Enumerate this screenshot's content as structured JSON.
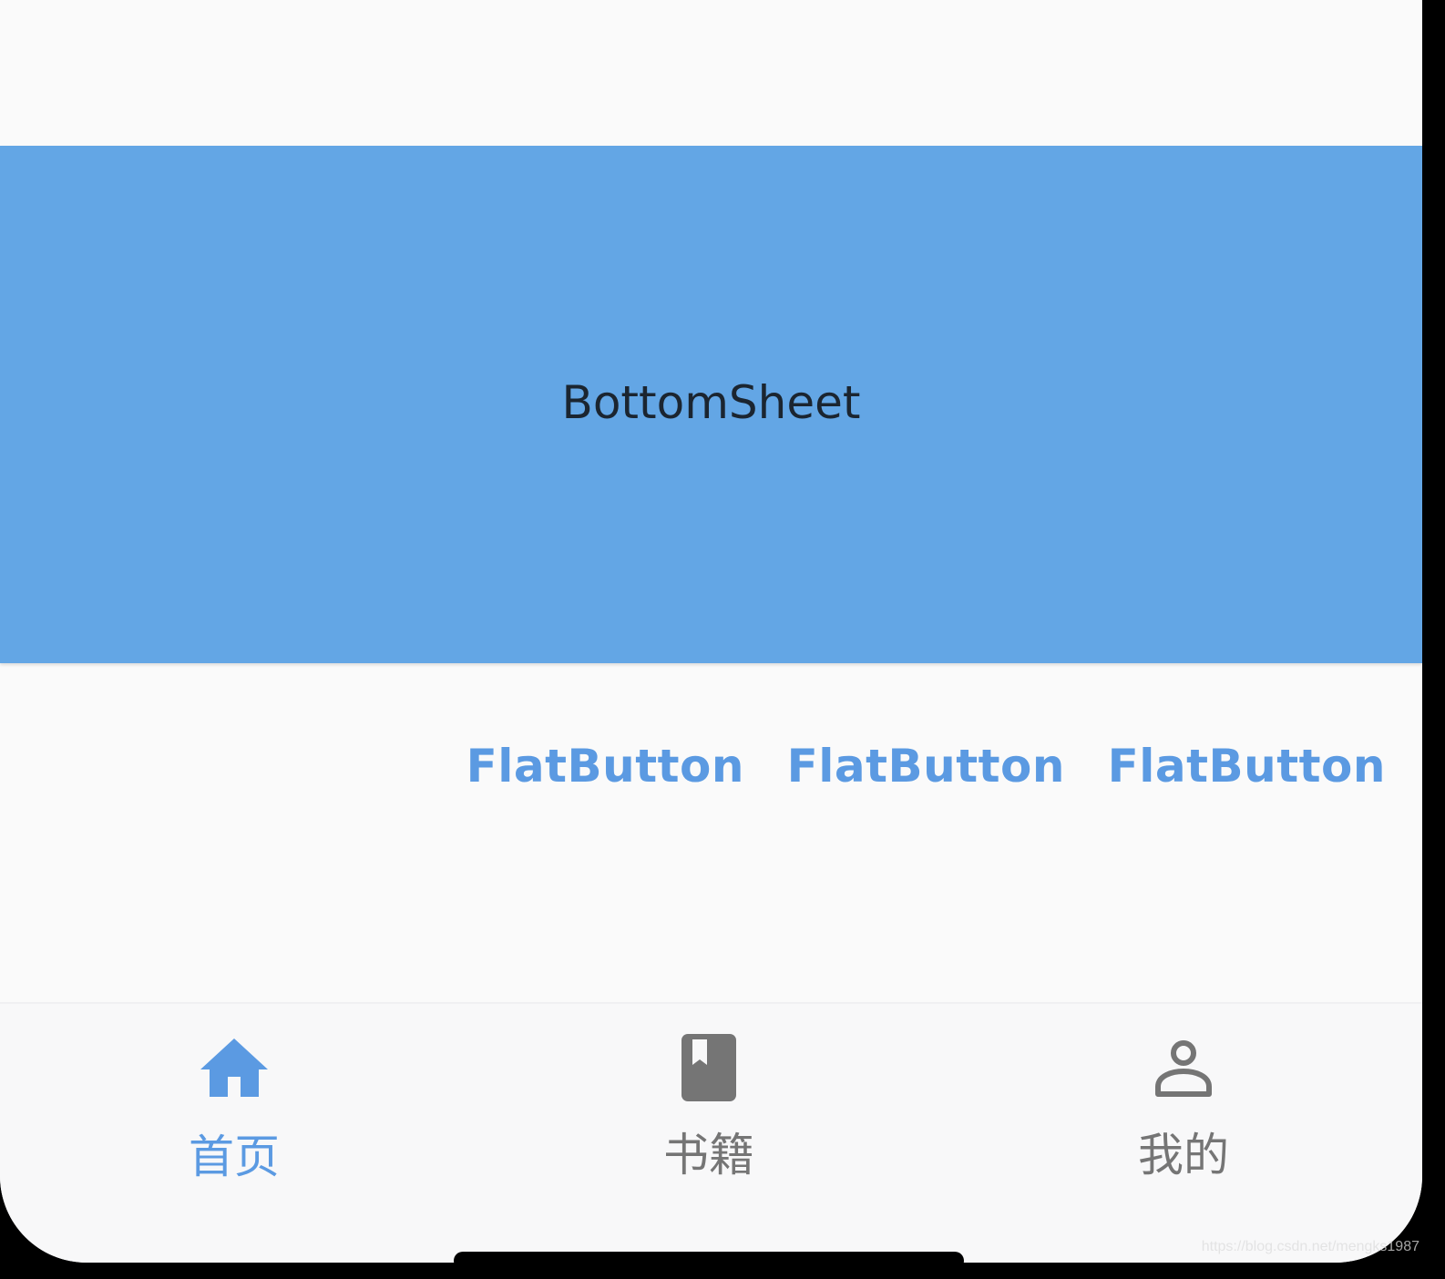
{
  "bottom_sheet": {
    "text": "BottomSheet"
  },
  "buttons": [
    {
      "label": "FlatButton"
    },
    {
      "label": "FlatButton"
    },
    {
      "label": "FlatButton"
    }
  ],
  "nav": {
    "items": [
      {
        "label": "首页",
        "icon": "home-icon",
        "active": true
      },
      {
        "label": "书籍",
        "icon": "book-icon",
        "active": false
      },
      {
        "label": "我的",
        "icon": "person-icon",
        "active": false
      }
    ]
  },
  "colors": {
    "accent": "#5b9ae2",
    "sheet": "#63a6e5",
    "inactive": "#757575",
    "background": "#fafafa"
  },
  "watermark": "https://blog.csdn.net/mengks1987"
}
